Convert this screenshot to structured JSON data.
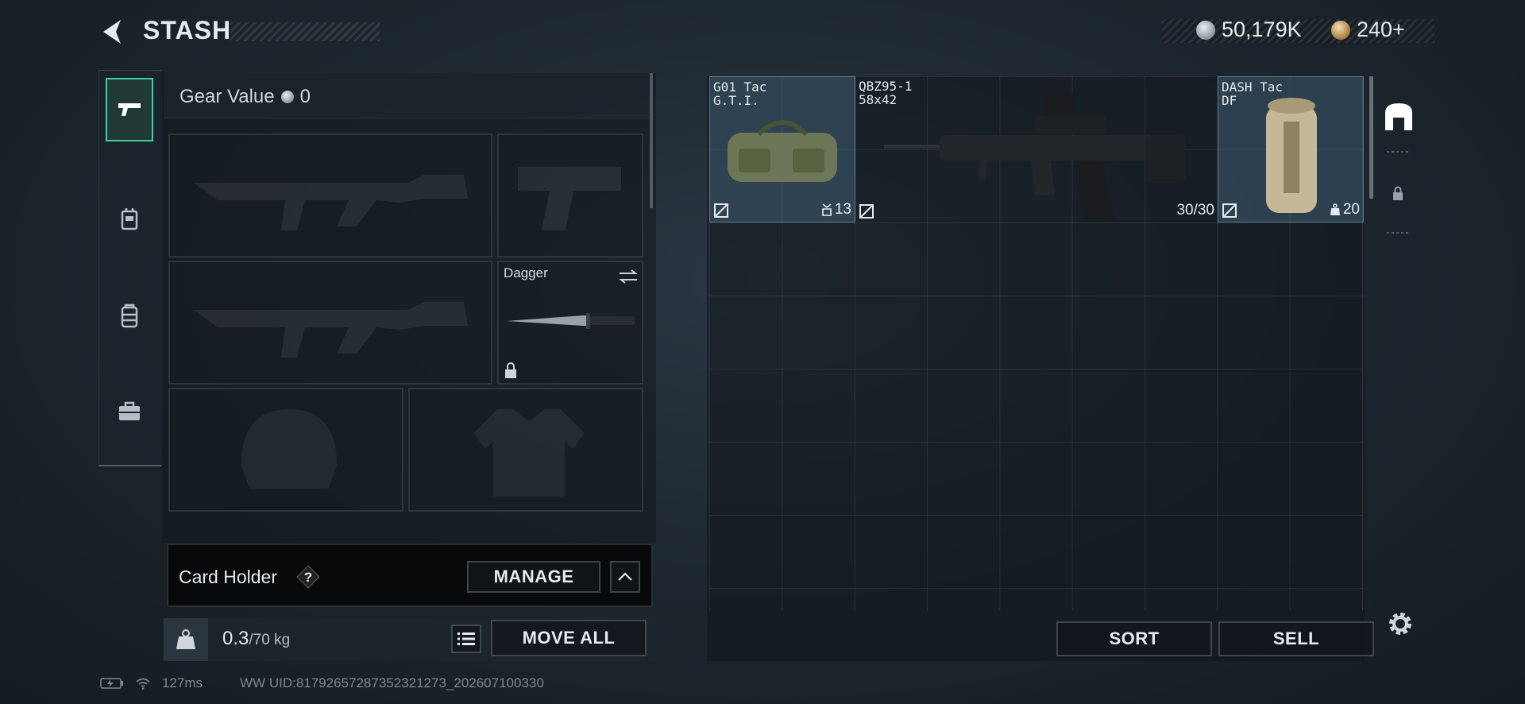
{
  "header": {
    "title": "STASH",
    "currencies": [
      {
        "icon": "silver-coin-icon",
        "value": "50,179K"
      },
      {
        "icon": "gold-coin-icon",
        "value": "240+"
      }
    ]
  },
  "rail": {
    "items": [
      {
        "icon": "pistol-icon",
        "active": true
      },
      {
        "icon": "rig-icon",
        "active": false
      },
      {
        "icon": "backpack-icon",
        "active": false
      },
      {
        "icon": "medkit-icon",
        "active": false
      }
    ]
  },
  "loadout": {
    "gear_value_label": "Gear Value",
    "gear_value": "0",
    "melee_slot_label": "Dagger",
    "card_holder_label": "Card Holder",
    "card_holder_help": "?",
    "manage_label": "MANAGE",
    "weight_value": "0.3",
    "weight_max": "/70 kg",
    "move_all_label": "MOVE ALL"
  },
  "stash": {
    "items": [
      {
        "name_line1": "G01 Tac",
        "name_line2": "G.T.I.",
        "stat": "13",
        "stat_icon": "capacity-icon"
      },
      {
        "name_line1": "QBZ95-1",
        "name_line2": "58x42",
        "stat": "30/30"
      },
      {
        "name_line1": "DASH Tac",
        "name_line2": "DF",
        "stat": "20",
        "stat_icon": "weight-bag-icon"
      }
    ],
    "sort_label": "SORT",
    "sell_label": "SELL"
  },
  "status": {
    "ping": "127ms",
    "uid": "WW UID:81792657287352321273_202607100330"
  },
  "colors": {
    "accent": "#3ccfa8",
    "highlight": "#496d84",
    "background": "#1c252d"
  }
}
